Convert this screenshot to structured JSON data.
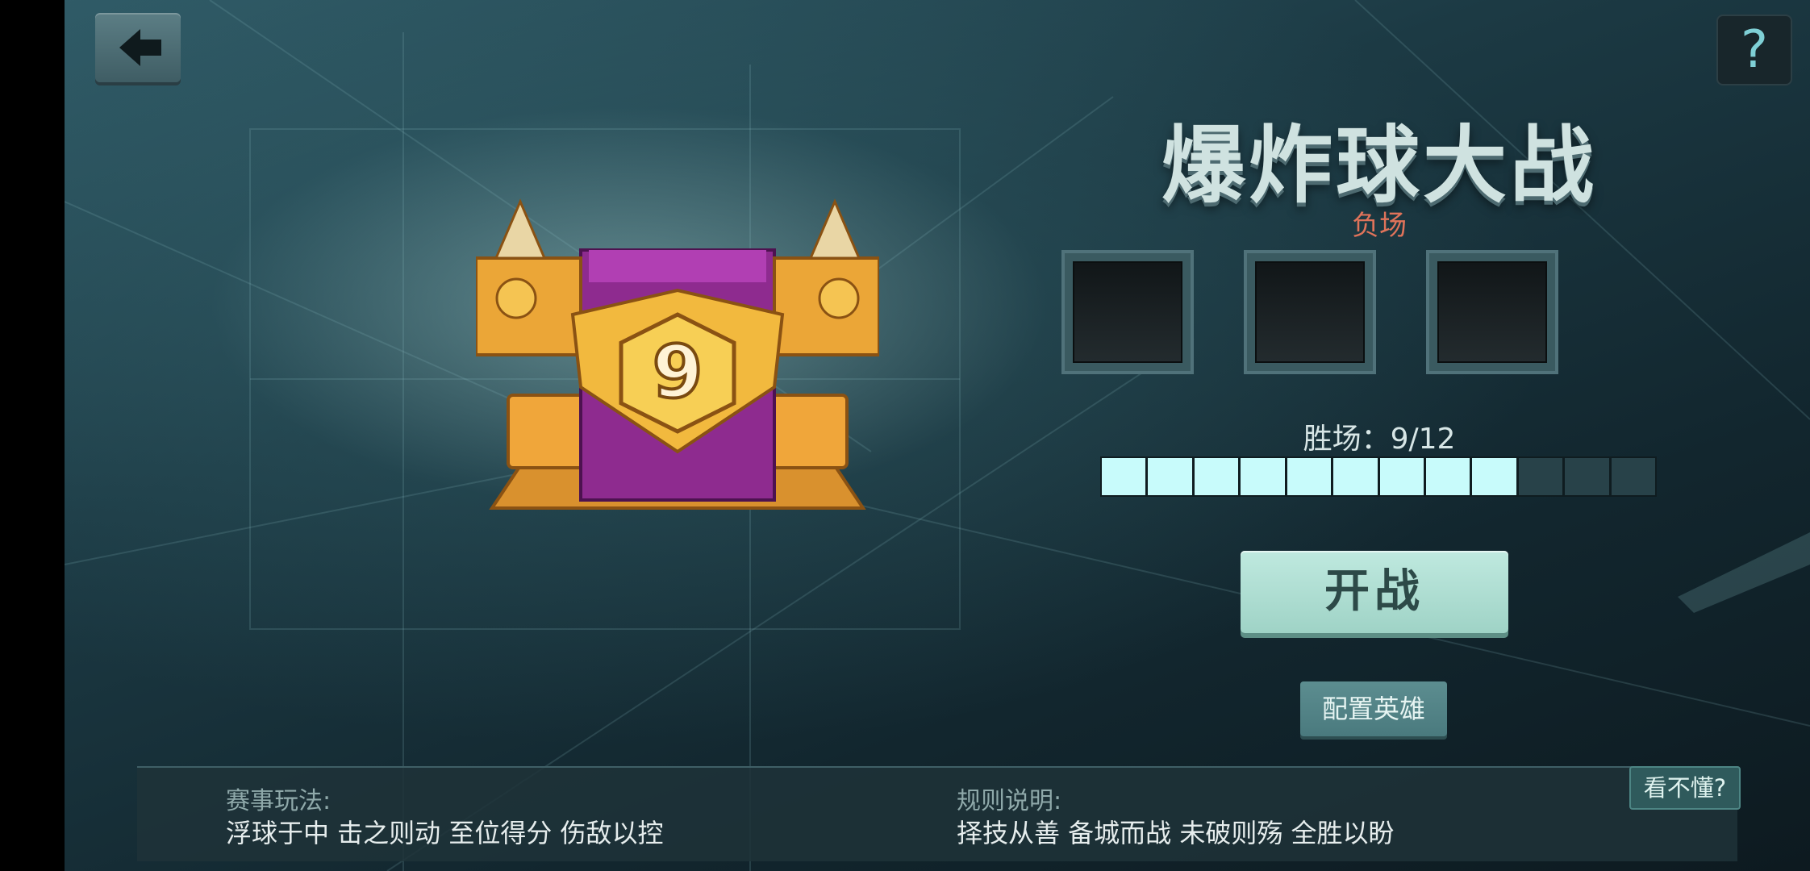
{
  "header": {
    "back_icon": "arrow-left-icon",
    "help_label": "?"
  },
  "mode": {
    "title": "爆炸球大战",
    "chest_level": "9"
  },
  "losses": {
    "label": "负场",
    "slots_filled": 0,
    "slots_total": 3
  },
  "wins": {
    "label": "胜场：9/12",
    "current": 9,
    "total": 12
  },
  "actions": {
    "start_label": "开战",
    "config_label": "配置英雄"
  },
  "info": {
    "gameplay_heading": "赛事玩法:",
    "gameplay_text": "浮球于中 击之则动 至位得分 伤敌以控",
    "rules_heading": "规则说明:",
    "rules_text": "择技从善 备城而战 未破则殇 全胜以盼",
    "confused_label": "看不懂?"
  },
  "colors": {
    "accent": "#c8fbfb",
    "loss_red": "#e0735a",
    "start_button": "#bfe9df"
  }
}
